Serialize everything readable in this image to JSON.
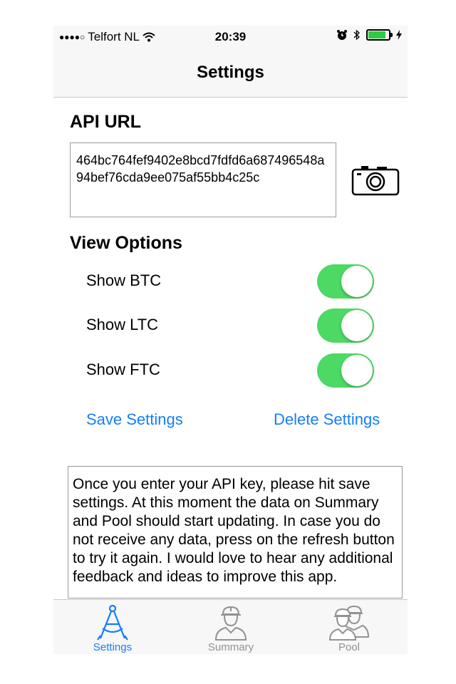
{
  "status_bar": {
    "signal_dots": "●●●●○",
    "carrier": "Telfort NL",
    "time": "20:39",
    "battery_color": "#2ecc40"
  },
  "nav": {
    "title": "Settings"
  },
  "api": {
    "section_title": "API URL",
    "value": "464bc764fef9402e8bcd7fdfd6a687496548a94bef76cda9ee075af55bb4c25c"
  },
  "view_options": {
    "section_title": "View Options",
    "items": [
      {
        "label": "Show BTC",
        "on": true
      },
      {
        "label": "Show LTC",
        "on": true
      },
      {
        "label": "Show FTC",
        "on": true
      }
    ]
  },
  "actions": {
    "save_label": "Save Settings",
    "delete_label": "Delete Settings"
  },
  "info_text": "Once you enter your API key, please hit save settings. At this moment the data on Summary and Pool should start updating. In case you do not receive any data, press on the refresh button to try it again. I would love to hear any additional feedback and ideas to improve this app.",
  "tabs": [
    {
      "label": "Settings",
      "icon": "compass-icon",
      "active": true
    },
    {
      "label": "Summary",
      "icon": "worker-icon",
      "active": false
    },
    {
      "label": "Pool",
      "icon": "workers-group-icon",
      "active": false
    }
  ],
  "colors": {
    "accent": "#147efb",
    "toggle_on": "#4cd964",
    "inactive": "#929292"
  }
}
